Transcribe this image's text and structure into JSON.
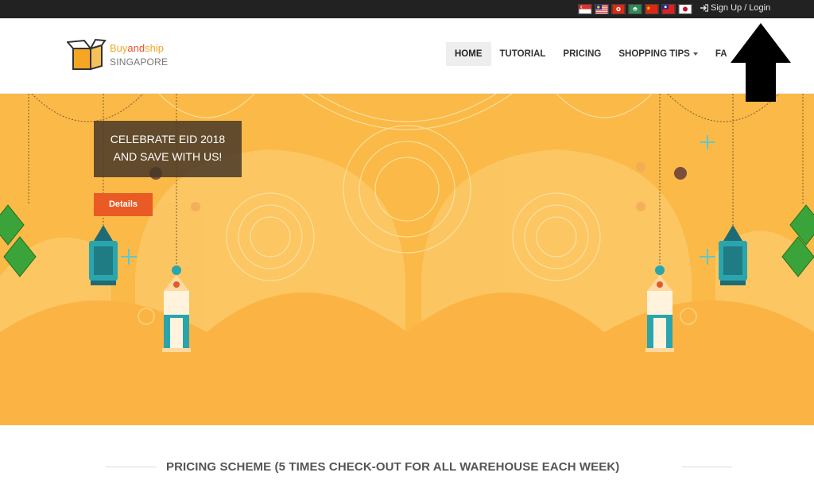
{
  "topbar": {
    "flags": [
      "singapore-flag",
      "malaysia-flag",
      "hong-kong-flag",
      "macau-flag",
      "china-flag",
      "taiwan-flag",
      "japan-flag"
    ],
    "login_label": "Sign Up / Login"
  },
  "header": {
    "logo": {
      "brand_part1": "Buy",
      "brand_part2": "and",
      "brand_part3": "ship",
      "country": "SINGAPORE"
    },
    "nav": [
      {
        "label": "HOME",
        "active": true
      },
      {
        "label": "TUTORIAL"
      },
      {
        "label": "PRICING"
      },
      {
        "label": "SHOPPING TIPS",
        "dropdown": true
      },
      {
        "label": "FA"
      }
    ]
  },
  "banner": {
    "promo_line1": "CELEBRATE EID 2018",
    "promo_line2": "AND SAVE WITH US!",
    "details_label": "Details"
  },
  "pricing": {
    "title": "PRICING SCHEME (5 TIMES CHECK-OUT FOR ALL WAREHOUSE EACH WEEK)"
  },
  "colors": {
    "topbar": "#222222",
    "banner": "#fbb947",
    "accent": "#ea5a24",
    "brand_yellow": "#f5a623"
  }
}
